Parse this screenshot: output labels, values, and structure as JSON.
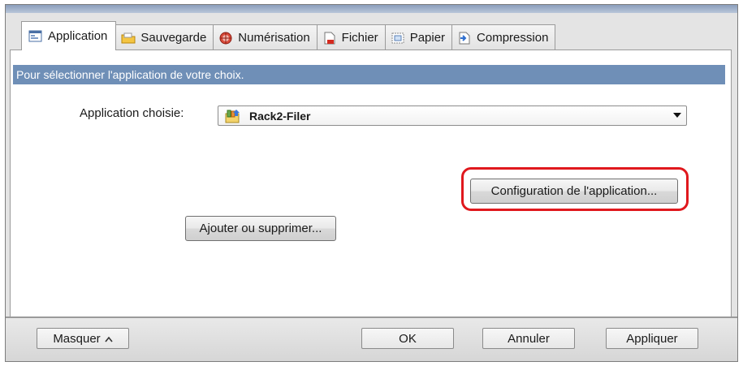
{
  "tabs": [
    {
      "label": "Application",
      "icon": "application-icon",
      "active": true
    },
    {
      "label": "Sauvegarde",
      "icon": "folder-icon",
      "active": false
    },
    {
      "label": "Numérisation",
      "icon": "scan-icon",
      "active": false
    },
    {
      "label": "Fichier",
      "icon": "file-icon",
      "active": false
    },
    {
      "label": "Papier",
      "icon": "paper-icon",
      "active": false
    },
    {
      "label": "Compression",
      "icon": "compression-icon",
      "active": false
    }
  ],
  "panel": {
    "description": "Pour sélectionner l'application de votre choix.",
    "app_label": "Application choisie:",
    "app_selected": "Rack2-Filer",
    "app_icon": "rack2-filer-icon",
    "config_button": "Configuration de l'application...",
    "add_remove_button": "Ajouter ou supprimer..."
  },
  "footer": {
    "hide_button": "Masquer",
    "hide_icon": "chevron-up-icon",
    "ok_button": "OK",
    "cancel_button": "Annuler",
    "apply_button": "Appliquer"
  },
  "colors": {
    "description_bar": "#6f8fb7",
    "highlight": "#e0181d"
  }
}
